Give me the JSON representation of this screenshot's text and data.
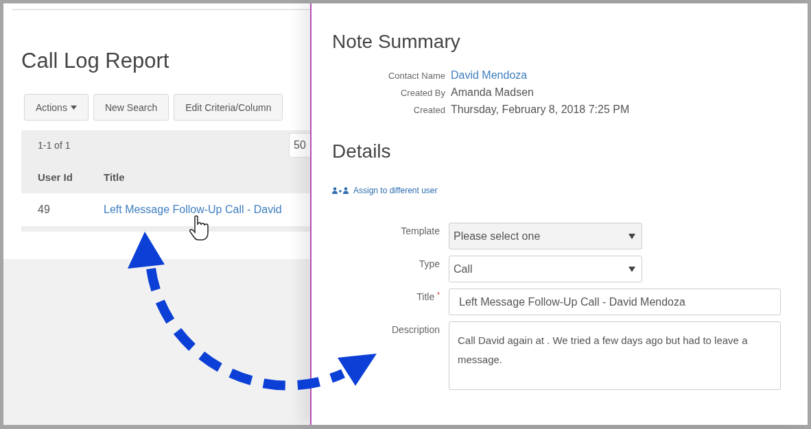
{
  "report": {
    "title": "Call Log Report",
    "toolbar": [
      {
        "label": "Actions",
        "kind": "dropdown"
      },
      {
        "label": "New Search",
        "kind": "button"
      },
      {
        "label": "Edit Criteria/Column",
        "kind": "button"
      }
    ],
    "pagination": "1-1 of 1",
    "page_size": "50",
    "columns": [
      "User Id",
      "Title"
    ],
    "rows": [
      {
        "user_id": "49",
        "title": "Left Message Follow-Up Call - David"
      }
    ]
  },
  "note": {
    "title": "Note Summary",
    "summary": [
      {
        "label": "Contact Name",
        "value": "David Mendoza",
        "kind": "link"
      },
      {
        "label": "Created By",
        "value": "Amanda Madsen",
        "kind": "text"
      },
      {
        "label": "Created",
        "value": "Thursday, February 8, 2018 7:25 PM",
        "kind": "text"
      }
    ],
    "details_title": "Details",
    "assign_link": "Assign to different user",
    "fields": [
      {
        "label": "Template",
        "kind": "select",
        "placeholder": "Please select one"
      },
      {
        "label": "Type",
        "kind": "select",
        "value": "Call"
      },
      {
        "label": "Title",
        "kind": "input",
        "value": "Left Message Follow-Up Call - David Mendoza",
        "required_mark": "*"
      },
      {
        "label": "Description",
        "kind": "textarea",
        "value": "Call David again at . We tried a few days ago but had to leave a message."
      }
    ]
  }
}
